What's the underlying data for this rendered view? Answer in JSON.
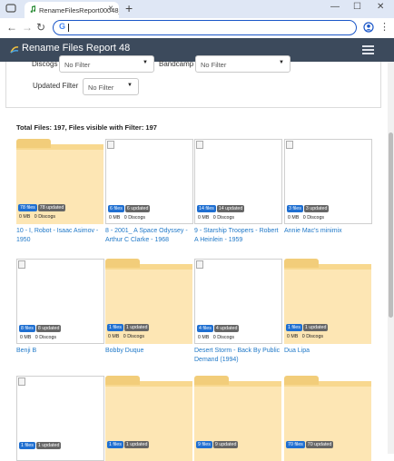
{
  "browser": {
    "tab_title": "RenameFilesReport00048_by...",
    "new_tab_label": "+",
    "minimize_label": "—",
    "maximize_label": "☐",
    "close_label": "✕",
    "address_value": ""
  },
  "navbar": {
    "title": "Rename Files Report 48"
  },
  "filters": {
    "discogs_label": "Discogs",
    "discogs_value": "No Filter",
    "bandcamp_label": "Bandcamp",
    "bandcamp_value": "No Filter",
    "updated_label": "Updated Filter",
    "updated_value": "No Filter"
  },
  "summary": "Total Files: 197, Files visible with Filter: 197",
  "tiles": [
    {
      "kind": "folder",
      "files": "78 files",
      "updated": "78 updated",
      "mb": "0 MB",
      "discogs": "0 Discogs",
      "caption": "10 - I, Robot - Isaac Asimov - 1950"
    },
    {
      "kind": "image",
      "files": "6 files",
      "updated": "6 updated",
      "mb": "0 MB",
      "discogs": "0 Discogs",
      "caption": "8 - 2001_ A Space Odyssey - Arthur C Clarke - 1968"
    },
    {
      "kind": "image",
      "files": "14 files",
      "updated": "14 updated",
      "mb": "0 MB",
      "discogs": "0 Discogs",
      "caption": "9 - Starship Troopers - Robert A Heinlein - 1959"
    },
    {
      "kind": "image",
      "files": "3 files",
      "updated": "3 updated",
      "mb": "0 MB",
      "discogs": "0 Discogs",
      "caption": "Annie Mac's minimix"
    },
    {
      "kind": "image",
      "files": "8 files",
      "updated": "8 updated",
      "mb": "0 MB",
      "discogs": "0 Discogs",
      "caption": "Benji B"
    },
    {
      "kind": "folder",
      "files": "1 files",
      "updated": "1 updated",
      "mb": "0 MB",
      "discogs": "0 Discogs",
      "caption": "Bobby Duque"
    },
    {
      "kind": "image",
      "files": "4 files",
      "updated": "4 updated",
      "mb": "0 MB",
      "discogs": "0 Discogs",
      "caption": "Desert Storm - Back By Public Demand (1994)"
    },
    {
      "kind": "folder",
      "files": "1 files",
      "updated": "1 updated",
      "mb": "0 MB",
      "discogs": "0 Discogs",
      "caption": "Dua Lipa"
    },
    {
      "kind": "image",
      "files": "1 files",
      "updated": "1 updated",
      "mb": "",
      "discogs": "",
      "caption": ""
    },
    {
      "kind": "folder",
      "files": "1 files",
      "updated": "1 updated",
      "mb": "",
      "discogs": "",
      "caption": ""
    },
    {
      "kind": "folder",
      "files": "9 files",
      "updated": "9 updated",
      "mb": "",
      "discogs": "",
      "caption": ""
    },
    {
      "kind": "folder",
      "files": "70 files",
      "updated": "70 updated",
      "mb": "",
      "discogs": "",
      "caption": ""
    }
  ]
}
